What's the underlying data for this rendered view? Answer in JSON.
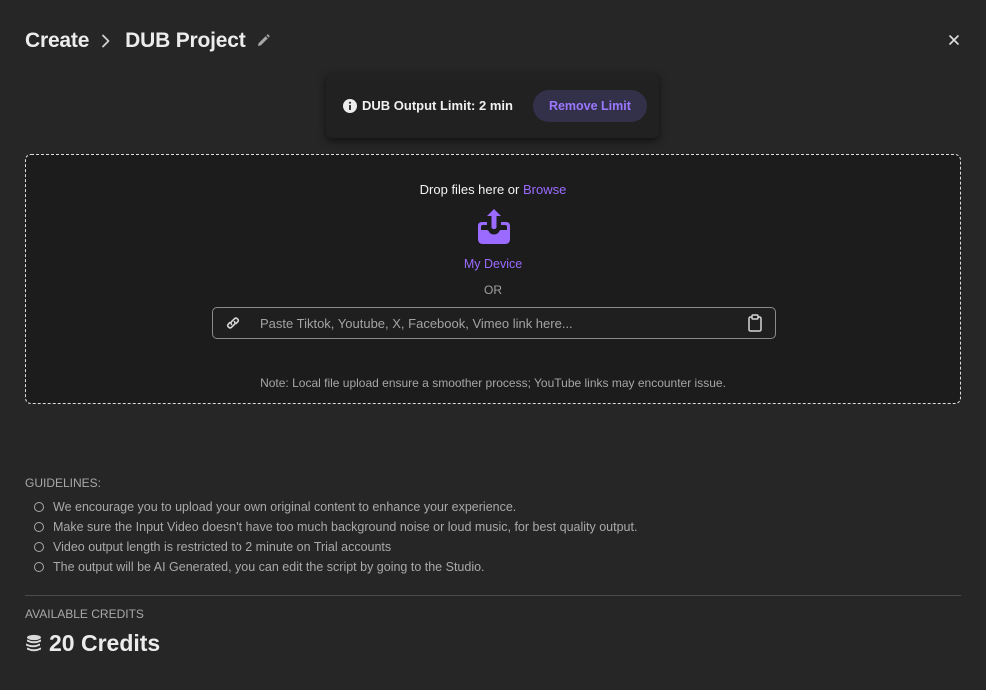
{
  "header": {
    "breadcrumb_root": "Create",
    "project_title": "DUB Project"
  },
  "limit_banner": {
    "text": "DUB Output Limit: 2 min",
    "button_label": "Remove Limit"
  },
  "upload": {
    "drop_text": "Drop files here or ",
    "browse_label": "Browse",
    "device_label": "My Device",
    "or_label": "OR",
    "link_placeholder": "Paste Tiktok, Youtube, X, Facebook, Vimeo link here...",
    "link_value": "",
    "note": "Note: Local file upload ensure a smoother process; YouTube links may encounter issue."
  },
  "guidelines": {
    "title": "GUIDELINES:",
    "items": [
      "We encourage you to upload your own original content to enhance your experience.",
      "Make sure the Input Video doesn't have too much background noise or loud music, for best quality output.",
      "Video output length is restricted to 2 minute on Trial accounts",
      "The output will be AI Generated, you can edit the script by going to the Studio."
    ]
  },
  "credits": {
    "title": "AVAILABLE CREDITS",
    "value": "20 Credits"
  },
  "icons": {
    "chevron": "chevron-right-icon",
    "edit": "pencil-icon",
    "close": "close-icon",
    "info": "info-icon",
    "upload": "upload-tray-icon",
    "link": "link-icon",
    "clipboard": "clipboard-icon",
    "coins": "coins-icon"
  },
  "colors": {
    "background": "#262626",
    "panel": "#1c1c1c",
    "accent": "#9b6bff",
    "button_bg": "#33304a"
  }
}
